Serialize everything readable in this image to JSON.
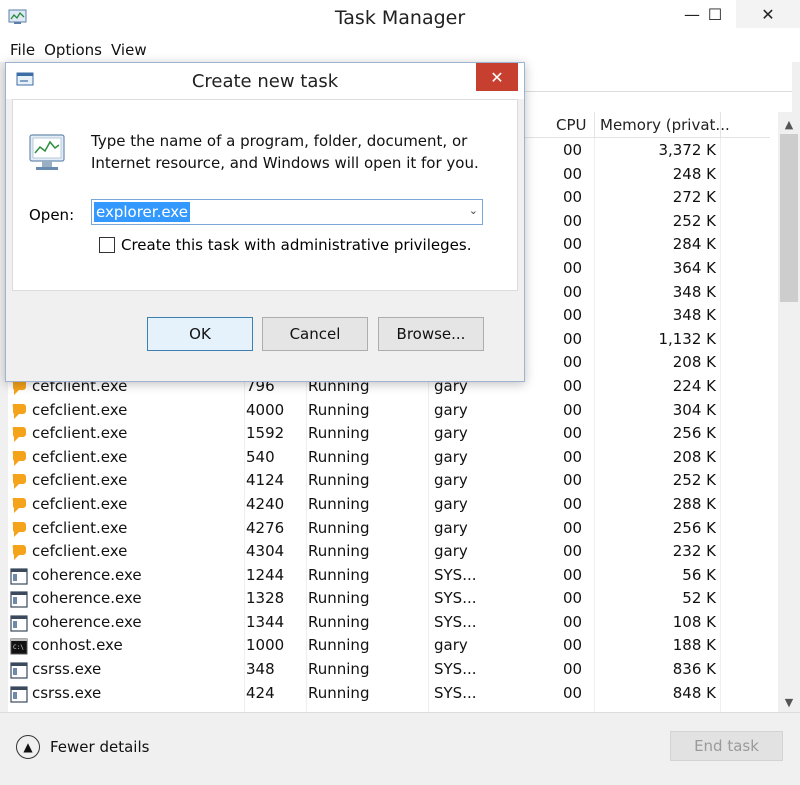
{
  "window": {
    "title": "Task Manager",
    "minimize": "—",
    "maximize": "☐",
    "close": "✕"
  },
  "menu": [
    "File",
    "Options",
    "View"
  ],
  "columns": {
    "cpu": "CPU",
    "memory": "Memory (privat..."
  },
  "processes": [
    {
      "icon": "",
      "name": "",
      "pid": "",
      "status": "",
      "user": "",
      "cpu": "00",
      "mem": "3,372 K"
    },
    {
      "icon": "",
      "name": "",
      "pid": "",
      "status": "",
      "user": "",
      "cpu": "00",
      "mem": "248 K"
    },
    {
      "icon": "",
      "name": "",
      "pid": "",
      "status": "",
      "user": "",
      "cpu": "00",
      "mem": "272 K"
    },
    {
      "icon": "",
      "name": "",
      "pid": "",
      "status": "",
      "user": "",
      "cpu": "00",
      "mem": "252 K"
    },
    {
      "icon": "",
      "name": "",
      "pid": "",
      "status": "",
      "user": "",
      "cpu": "00",
      "mem": "284 K"
    },
    {
      "icon": "",
      "name": "",
      "pid": "",
      "status": "",
      "user": "",
      "cpu": "00",
      "mem": "364 K"
    },
    {
      "icon": "",
      "name": "",
      "pid": "",
      "status": "",
      "user": "",
      "cpu": "00",
      "mem": "348 K"
    },
    {
      "icon": "",
      "name": "",
      "pid": "",
      "status": "",
      "user": "",
      "cpu": "00",
      "mem": "348 K"
    },
    {
      "icon": "",
      "name": "",
      "pid": "",
      "status": "",
      "user": "",
      "cpu": "00",
      "mem": "1,132 K"
    },
    {
      "icon": "",
      "name": "",
      "pid": "",
      "status": "",
      "user": "",
      "cpu": "00",
      "mem": "208 K"
    },
    {
      "icon": "cef",
      "name": "cefclient.exe",
      "pid": "796",
      "status": "Running",
      "user": "gary",
      "cpu": "00",
      "mem": "224 K"
    },
    {
      "icon": "cef",
      "name": "cefclient.exe",
      "pid": "4000",
      "status": "Running",
      "user": "gary",
      "cpu": "00",
      "mem": "304 K"
    },
    {
      "icon": "cef",
      "name": "cefclient.exe",
      "pid": "1592",
      "status": "Running",
      "user": "gary",
      "cpu": "00",
      "mem": "256 K"
    },
    {
      "icon": "cef",
      "name": "cefclient.exe",
      "pid": "540",
      "status": "Running",
      "user": "gary",
      "cpu": "00",
      "mem": "208 K"
    },
    {
      "icon": "cef",
      "name": "cefclient.exe",
      "pid": "4124",
      "status": "Running",
      "user": "gary",
      "cpu": "00",
      "mem": "252 K"
    },
    {
      "icon": "cef",
      "name": "cefclient.exe",
      "pid": "4240",
      "status": "Running",
      "user": "gary",
      "cpu": "00",
      "mem": "288 K"
    },
    {
      "icon": "cef",
      "name": "cefclient.exe",
      "pid": "4276",
      "status": "Running",
      "user": "gary",
      "cpu": "00",
      "mem": "256 K"
    },
    {
      "icon": "cef",
      "name": "cefclient.exe",
      "pid": "4304",
      "status": "Running",
      "user": "gary",
      "cpu": "00",
      "mem": "232 K"
    },
    {
      "icon": "app",
      "name": "coherence.exe",
      "pid": "1244",
      "status": "Running",
      "user": "SYS...",
      "cpu": "00",
      "mem": "56 K"
    },
    {
      "icon": "app",
      "name": "coherence.exe",
      "pid": "1328",
      "status": "Running",
      "user": "SYS...",
      "cpu": "00",
      "mem": "52 K"
    },
    {
      "icon": "app",
      "name": "coherence.exe",
      "pid": "1344",
      "status": "Running",
      "user": "SYS...",
      "cpu": "00",
      "mem": "108 K"
    },
    {
      "icon": "console",
      "name": "conhost.exe",
      "pid": "1000",
      "status": "Running",
      "user": "gary",
      "cpu": "00",
      "mem": "188 K"
    },
    {
      "icon": "app",
      "name": "csrss.exe",
      "pid": "348",
      "status": "Running",
      "user": "SYS...",
      "cpu": "00",
      "mem": "836 K"
    },
    {
      "icon": "app",
      "name": "csrss.exe",
      "pid": "424",
      "status": "Running",
      "user": "SYS...",
      "cpu": "00",
      "mem": "848 K"
    }
  ],
  "bottom": {
    "fewer_details": "Fewer details",
    "end_task": "End task"
  },
  "dialog": {
    "title": "Create new task",
    "close": "✕",
    "description": "Type the name of a program, folder, document, or Internet resource, and Windows will open it for you.",
    "open_label": "Open:",
    "open_value": "explorer.exe",
    "admin_label": "Create this task with administrative privileges.",
    "ok": "OK",
    "cancel": "Cancel",
    "browse": "Browse..."
  },
  "colors": {
    "cef_icon": "#f5a31a",
    "selection": "#3399ff",
    "close_red": "#c7402f"
  }
}
